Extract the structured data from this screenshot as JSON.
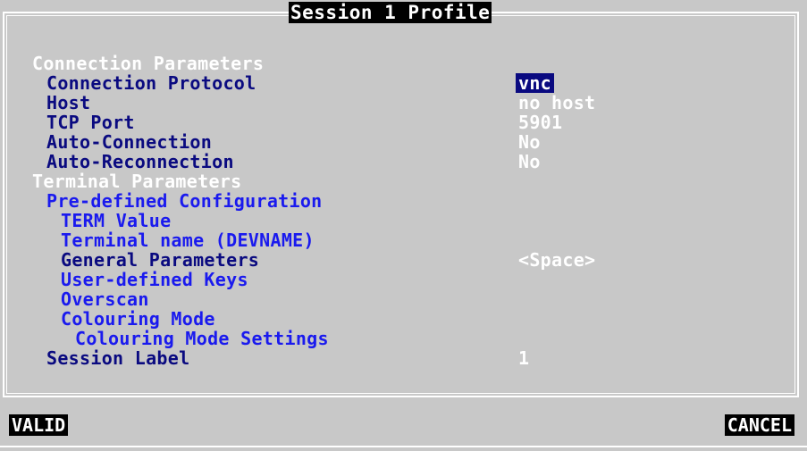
{
  "window": {
    "title": "Session 1 Profile"
  },
  "sections": {
    "connection": "Connection Parameters",
    "terminal": "Terminal Parameters"
  },
  "fields": {
    "protocol": {
      "label": "Connection Protocol",
      "value": "vnc"
    },
    "host": {
      "label": "Host",
      "value": "no host"
    },
    "tcp_port": {
      "label": "TCP Port",
      "value": "5901"
    },
    "auto_connection": {
      "label": "Auto-Connection",
      "value": "No"
    },
    "auto_reconnection": {
      "label": "Auto-Reconnection",
      "value": "No"
    },
    "predefined_config": {
      "label": "Pre-defined Configuration"
    },
    "term_value": {
      "label": "TERM Value"
    },
    "terminal_name": {
      "label": "Terminal name (DEVNAME)"
    },
    "general_params": {
      "label": "General Parameters",
      "value": "<Space>"
    },
    "user_keys": {
      "label": "User-defined Keys"
    },
    "overscan": {
      "label": "Overscan"
    },
    "colouring_mode": {
      "label": "Colouring Mode"
    },
    "colouring_settings": {
      "label": "Colouring Mode Settings"
    },
    "session_label": {
      "label": "Session Label",
      "value": "1"
    }
  },
  "buttons": {
    "valid": "VALID",
    "cancel": "CANCEL"
  },
  "colors": {
    "background": "#c8c8c8",
    "selection": "#0a0a80",
    "link": "#1a1aee",
    "text": "#ffffff"
  }
}
